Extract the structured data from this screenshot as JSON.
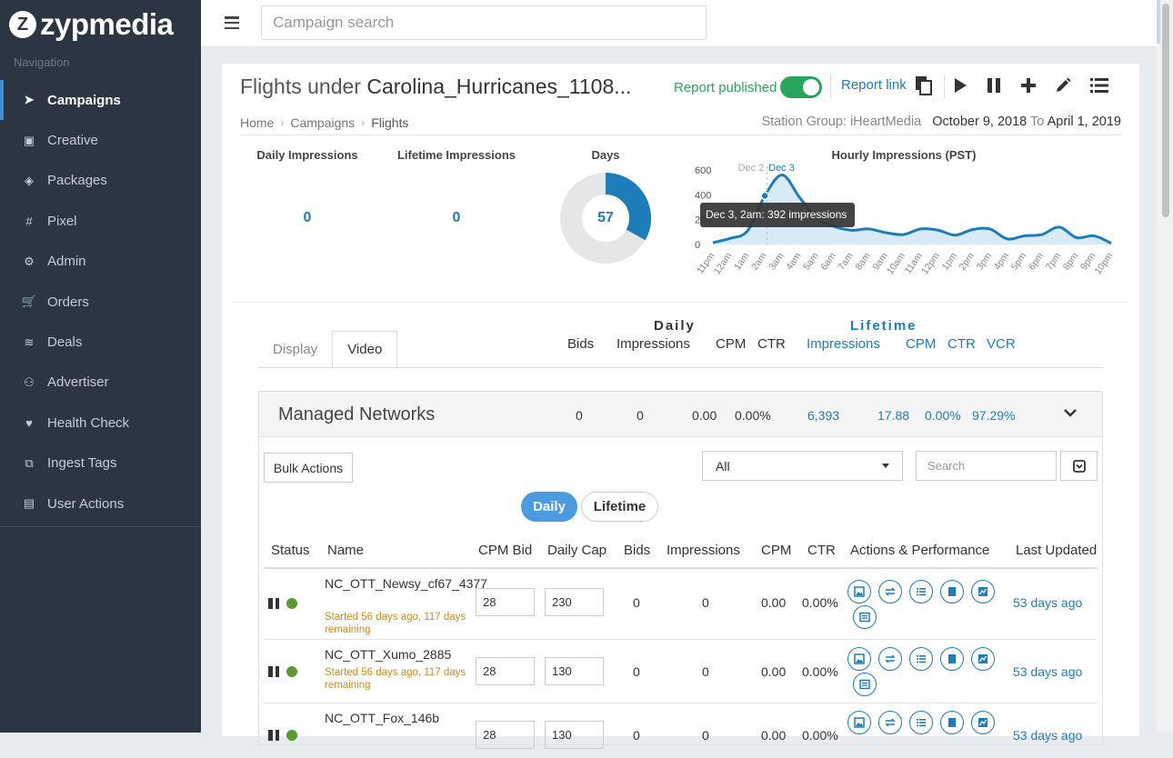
{
  "brand": {
    "name": "zypmedia",
    "mark": "Z"
  },
  "sidebar": {
    "heading": "Navigation",
    "items": [
      {
        "label": "Campaigns",
        "icon": "rocket-icon",
        "glyph": "➤",
        "active": true
      },
      {
        "label": "Creative",
        "icon": "image-icon",
        "glyph": "▣",
        "active": false
      },
      {
        "label": "Packages",
        "icon": "layers-icon",
        "glyph": "◈",
        "active": false
      },
      {
        "label": "Pixel",
        "icon": "hashtag-icon",
        "glyph": "#",
        "active": false
      },
      {
        "label": "Admin",
        "icon": "gears-icon",
        "glyph": "⚙",
        "active": false
      },
      {
        "label": "Orders",
        "icon": "cart-icon",
        "glyph": "🛒",
        "active": false
      },
      {
        "label": "Deals",
        "icon": "money-icon",
        "glyph": "≋",
        "active": false
      },
      {
        "label": "Advertiser",
        "icon": "sitemap-icon",
        "glyph": "⚇",
        "active": false
      },
      {
        "label": "Health Check",
        "icon": "heartbeat-icon",
        "glyph": "♥",
        "active": false
      },
      {
        "label": "Ingest Tags",
        "icon": "tags-icon",
        "glyph": "⧉",
        "active": false
      },
      {
        "label": "User Actions",
        "icon": "book-icon",
        "glyph": "▤",
        "active": false
      }
    ]
  },
  "topbar": {
    "search_placeholder": "Campaign search"
  },
  "page": {
    "title_prefix": "Flights under ",
    "title_name": "Carolina_Hurricanes_1108...",
    "published_label": "Report published",
    "report_link": "Report link",
    "breadcrumb": [
      "Home",
      "Campaigns",
      "Flights"
    ],
    "station_label": "Station Group: iHeartMedia",
    "date_start": "October 9, 2018",
    "date_to": "To",
    "date_end": "April 1, 2019"
  },
  "stats": {
    "daily_label": "Daily Impressions",
    "daily_value": "0",
    "lifetime_label": "Lifetime Impressions",
    "lifetime_value": "0",
    "days_label": "Days",
    "days_value": "57",
    "days_fraction": 0.33,
    "hourly_title": "Hourly Impressions (PST)"
  },
  "chart_data": {
    "type": "area",
    "title": "Hourly Impressions (PST)",
    "ylim": [
      0,
      600
    ],
    "yticks": [
      "600",
      "400",
      "200",
      "0"
    ],
    "x": [
      "11pm",
      "12am",
      "1am",
      "2am",
      "3am",
      "4am",
      "5am",
      "6am",
      "7am",
      "8am",
      "9am",
      "10am",
      "11am",
      "12pm",
      "1pm",
      "2pm",
      "3pm",
      "4pm",
      "5pm",
      "6pm",
      "7pm",
      "8pm",
      "9pm",
      "10pm"
    ],
    "values": [
      15,
      50,
      110,
      392,
      560,
      380,
      210,
      145,
      115,
      125,
      95,
      80,
      125,
      115,
      75,
      120,
      125,
      45,
      70,
      80,
      140,
      55,
      70,
      10
    ],
    "markers": [
      "Dec 2",
      "Dec 3"
    ],
    "tooltip": "Dec 3, 2am: 392 impressions",
    "color": "#1c7db9"
  },
  "table_header": {
    "tabs": [
      "Display",
      "Video"
    ],
    "daily_group": "Daily",
    "lifetime_group": "Lifetime",
    "bids": "Bids",
    "impressions": "Impressions",
    "cpm": "CPM",
    "ctr": "CTR",
    "vcr": "VCR"
  },
  "managed": {
    "title": "Managed Networks",
    "bids": "0",
    "impressions": "0",
    "cpm": "0.00",
    "ctr": "0.00%",
    "lt_impressions": "6,393",
    "lt_cpm": "17.88",
    "lt_ctr": "0.00%",
    "lt_vcr": "97.29%",
    "bulk_actions": "Bulk Actions",
    "filter_value": "All",
    "search_placeholder": "Search",
    "pill_daily": "Daily",
    "pill_lifetime": "Lifetime",
    "columns": [
      "Status",
      "Name",
      "CPM Bid",
      "Daily Cap",
      "Bids",
      "Impressions",
      "CPM",
      "CTR",
      "Actions & Performance",
      "Last Updated"
    ],
    "rows": [
      {
        "name": "NC_OTT_Newsy_cf67_4377",
        "status": "Started 56 days ago, 117 days remaining",
        "cpm_bid": "28",
        "daily_cap": "230",
        "bids": "0",
        "impressions": "0",
        "cpm": "0.00",
        "ctr": "0.00%",
        "updated": "53 days ago"
      },
      {
        "name": "NC_OTT_Xumo_2885",
        "status": "Started 56 days ago, 117 days remaining",
        "cpm_bid": "28",
        "daily_cap": "130",
        "bids": "0",
        "impressions": "0",
        "cpm": "0.00",
        "ctr": "0.00%",
        "updated": "53 days ago"
      },
      {
        "name": "NC_OTT_Fox_146b",
        "status": "",
        "cpm_bid": "28",
        "daily_cap": "130",
        "bids": "0",
        "impressions": "0",
        "cpm": "0.00",
        "ctr": "0.00%",
        "updated": "53 days ago"
      }
    ]
  }
}
